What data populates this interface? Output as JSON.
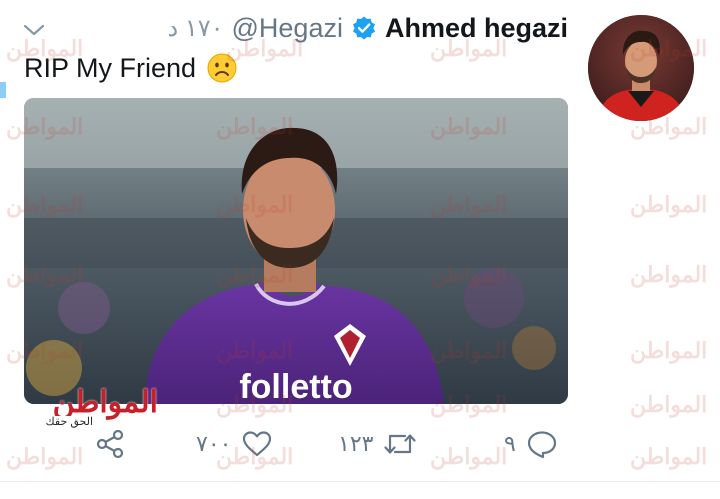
{
  "tweet": {
    "display_name": "Ahmed hegazi",
    "handle": "@Hegazi",
    "time": "١٧٠ د",
    "text": "RIP My Friend"
  },
  "actions": {
    "reply_count": "٩",
    "retweet_count": "١٢٣",
    "like_count": "٧٠٠"
  },
  "watermark": {
    "brand": "المواطن",
    "tagline": "الحق حقك"
  },
  "icons": {
    "verified": "verified-badge-icon",
    "menu": "chevron-down-icon",
    "reply": "reply-icon",
    "retweet": "retweet-icon",
    "like": "heart-icon",
    "share": "share-icon",
    "emoji": "frowning-face-emoji"
  },
  "colors": {
    "verified_blue": "#1da1f2",
    "text_primary": "#14171a",
    "text_secondary": "#657786",
    "icon_gray": "#657786",
    "watermark_red": "#c8202a",
    "jersey_purple": "#5b2d8e"
  }
}
